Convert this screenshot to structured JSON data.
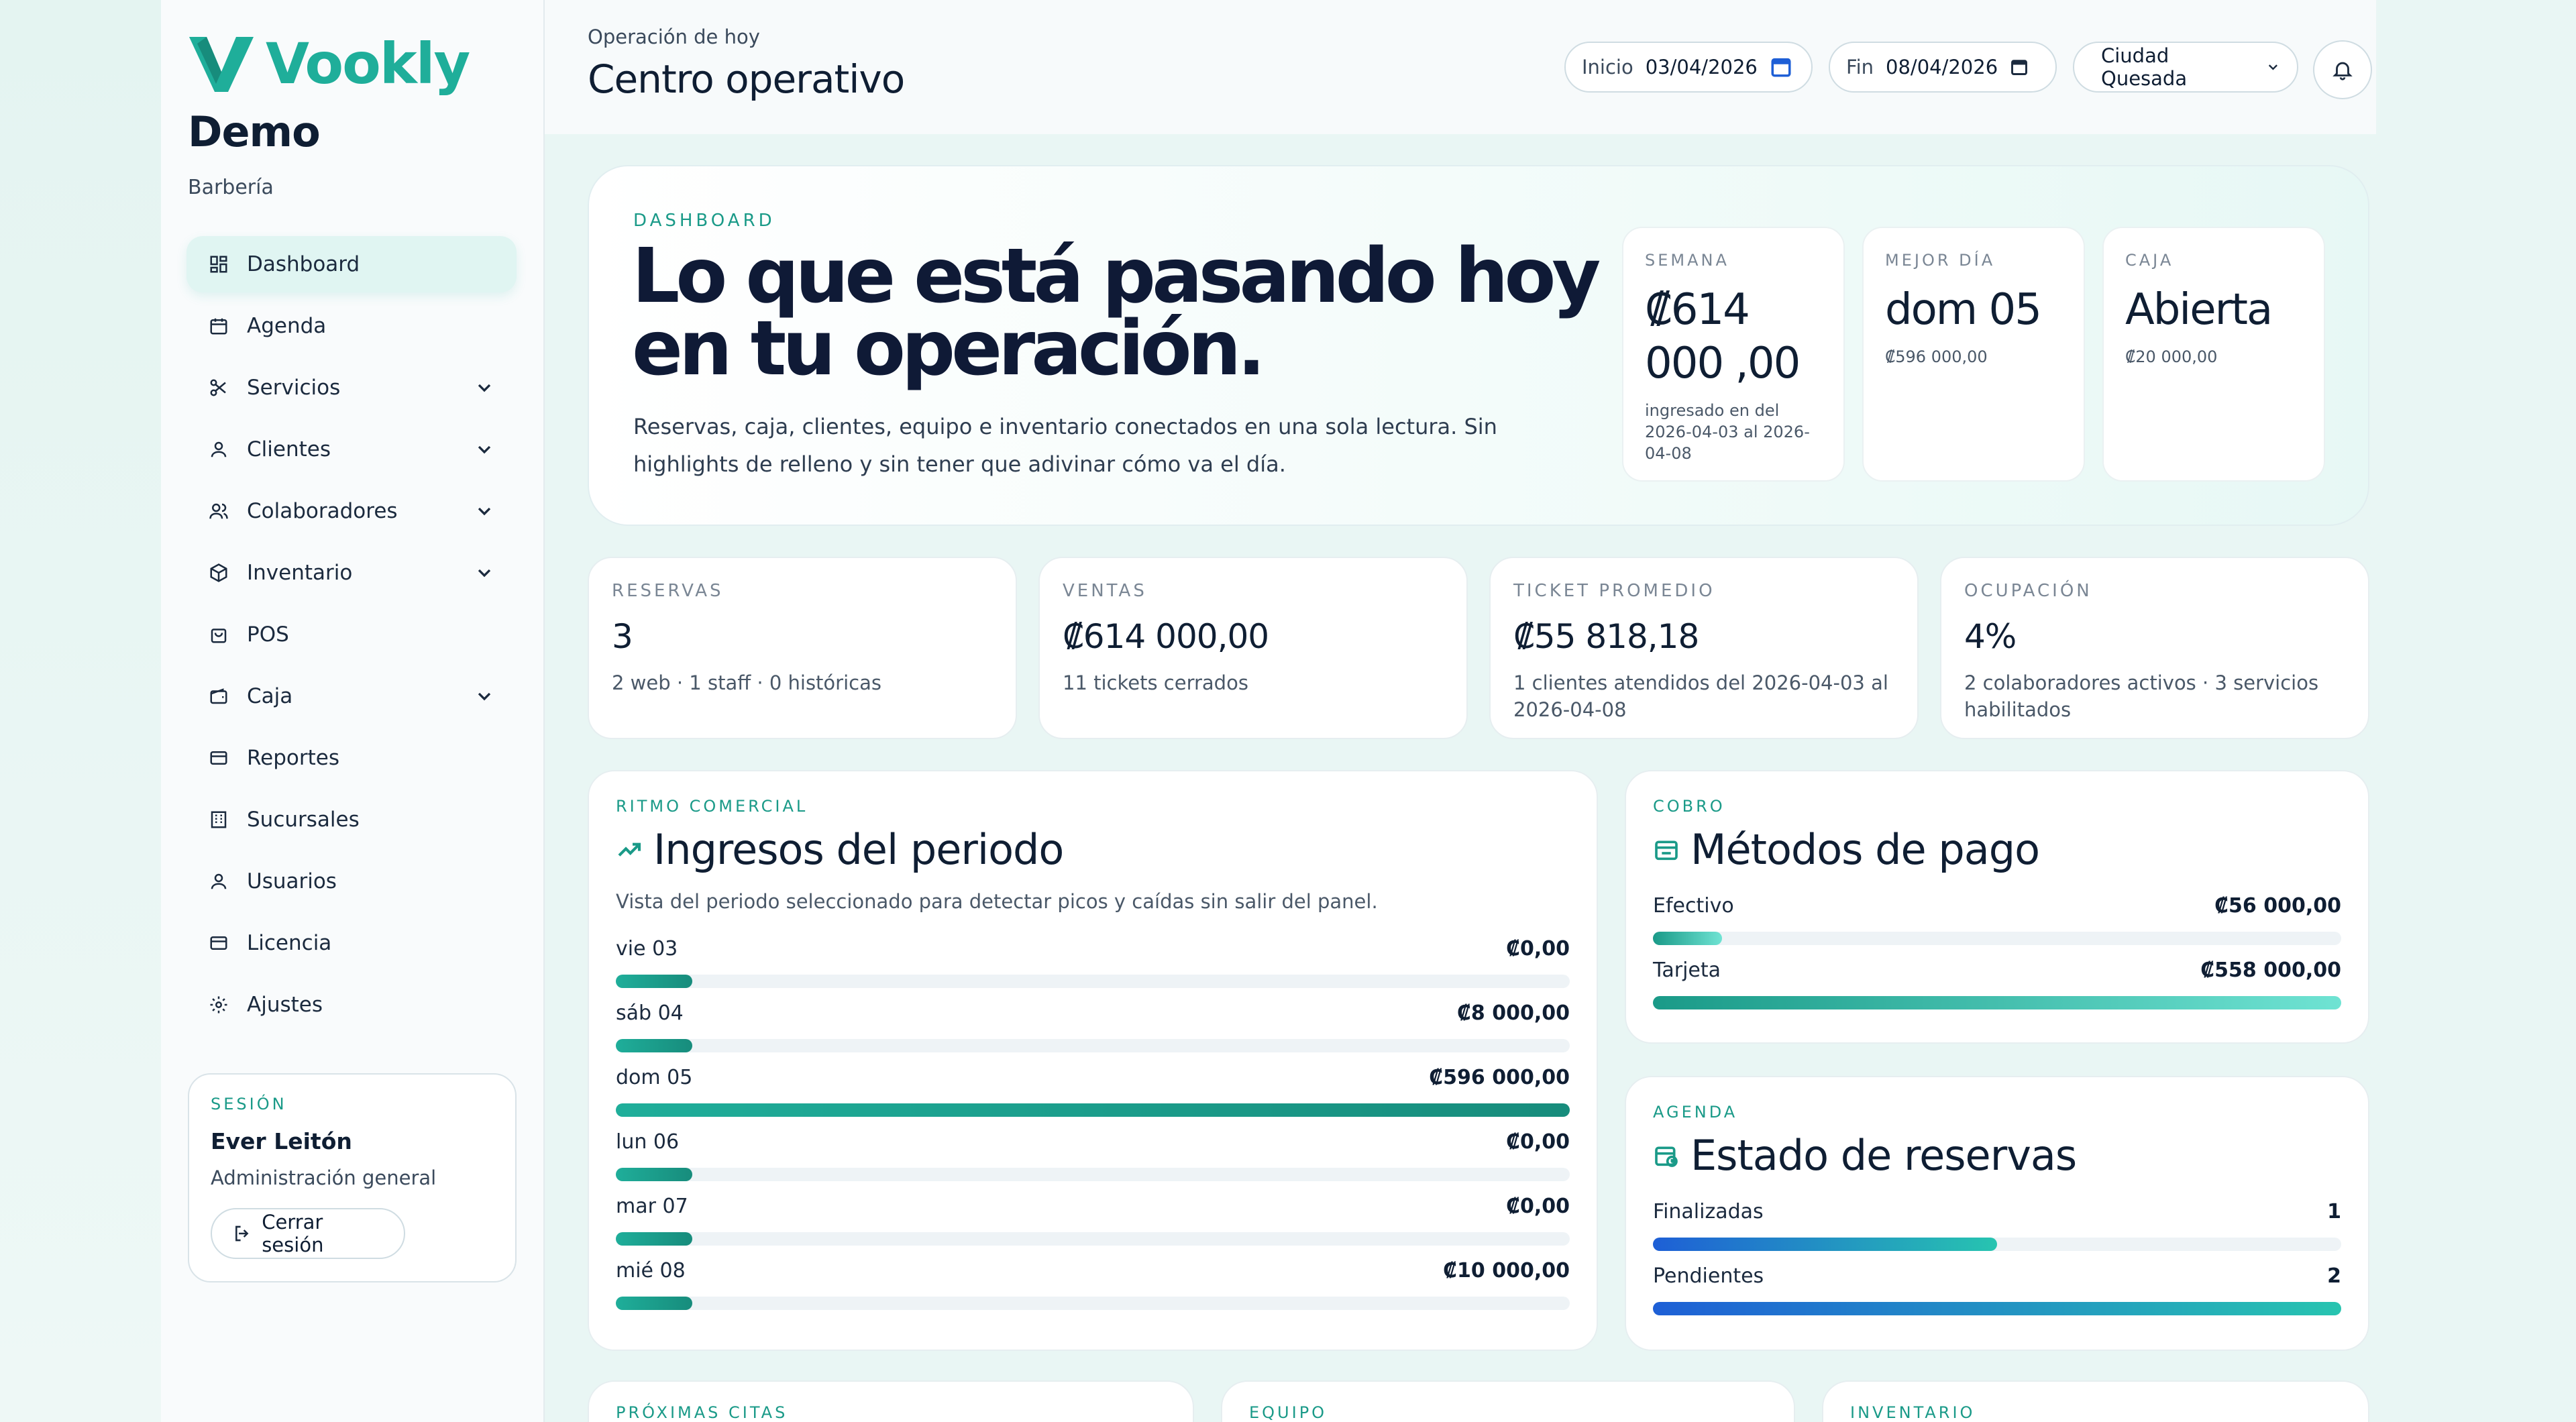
{
  "brand": {
    "name": "Vookly"
  },
  "business": {
    "name": "Demo",
    "type": "Barbería"
  },
  "nav": [
    {
      "label": "Dashboard",
      "icon": "dashboard-icon",
      "expandable": false,
      "active": true
    },
    {
      "label": "Agenda",
      "icon": "calendar-icon",
      "expandable": false
    },
    {
      "label": "Servicios",
      "icon": "scissors-icon",
      "expandable": true
    },
    {
      "label": "Clientes",
      "icon": "user-icon",
      "expandable": true
    },
    {
      "label": "Colaboradores",
      "icon": "users-icon",
      "expandable": true
    },
    {
      "label": "Inventario",
      "icon": "box-icon",
      "expandable": true
    },
    {
      "label": "POS",
      "icon": "bag-icon",
      "expandable": false
    },
    {
      "label": "Caja",
      "icon": "wallet-icon",
      "expandable": true
    },
    {
      "label": "Reportes",
      "icon": "card-icon",
      "expandable": false
    },
    {
      "label": "Sucursales",
      "icon": "building-icon",
      "expandable": false
    },
    {
      "label": "Usuarios",
      "icon": "user-icon",
      "expandable": false
    },
    {
      "label": "Licencia",
      "icon": "card-icon",
      "expandable": false
    },
    {
      "label": "Ajustes",
      "icon": "gear-icon",
      "expandable": false
    }
  ],
  "session": {
    "label": "SESIÓN",
    "name": "Ever Leitón",
    "role": "Administración general",
    "logout": "Cerrar sesión"
  },
  "header": {
    "crumb": "Operación de hoy",
    "title": "Centro operativo",
    "start_label": "Inicio",
    "start_value": "03/04/2026",
    "end_label": "Fin",
    "end_value": "08/04/2026",
    "branch": "Ciudad Quesada"
  },
  "hero": {
    "tag": "DASHBOARD",
    "title": "Lo que está pasando hoy en tu operación.",
    "desc": "Reservas, caja, clientes, equipo e inventario conectados en una sola lectura. Sin highlights de relleno y sin tener que adivinar cómo va el día.",
    "cards": [
      {
        "label": "SEMANA",
        "value": "₡614 000 ,00",
        "sub": "ingresado en del 2026-04-03 al 2026-04-08"
      },
      {
        "label": "MEJOR DÍA",
        "value": "dom 05",
        "sub": "₡596 000,00"
      },
      {
        "label": "CAJA",
        "value": "Abierta",
        "sub": "₡20 000,00"
      }
    ]
  },
  "kpis": [
    {
      "label": "RESERVAS",
      "value": "3",
      "sub": "2 web · 1 staff · 0 históricas"
    },
    {
      "label": "VENTAS",
      "value": "₡614 000,00",
      "sub": "11 tickets cerrados"
    },
    {
      "label": "TICKET PROMEDIO",
      "value": "₡55 818,18",
      "sub": "1 clientes atendidos del 2026-04-03 al 2026-04-08"
    },
    {
      "label": "OCUPACIÓN",
      "value": "4%",
      "sub": "2 colaboradores activos · 3 servicios habilitados"
    }
  ],
  "income": {
    "tag": "RITMO COMERCIAL",
    "title": "Ingresos del periodo",
    "desc": "Vista del periodo seleccionado para detectar picos y caídas sin salir del panel.",
    "rows": [
      {
        "day": "vie 03",
        "value": "₡0,00",
        "fraction": 0.08
      },
      {
        "day": "sáb 04",
        "value": "₡8 000,00",
        "fraction": 0.08
      },
      {
        "day": "dom 05",
        "value": "₡596 000,00",
        "fraction": 1.0
      },
      {
        "day": "lun 06",
        "value": "₡0,00",
        "fraction": 0.08
      },
      {
        "day": "mar 07",
        "value": "₡0,00",
        "fraction": 0.08
      },
      {
        "day": "mié 08",
        "value": "₡10 000,00",
        "fraction": 0.08
      }
    ]
  },
  "payments": {
    "tag": "COBRO",
    "title": "Métodos de pago",
    "rows": [
      {
        "label": "Efectivo",
        "value": "₡56 000,00",
        "fraction": 0.1
      },
      {
        "label": "Tarjeta",
        "value": "₡558 000,00",
        "fraction": 1.0
      }
    ]
  },
  "bookings": {
    "tag": "AGENDA",
    "title": "Estado de reservas",
    "rows": [
      {
        "label": "Finalizadas",
        "value": "1",
        "fraction": 0.5
      },
      {
        "label": "Pendientes",
        "value": "2",
        "fraction": 1.0
      }
    ]
  },
  "bottom_tags": [
    "PRÓXIMAS CITAS",
    "EQUIPO",
    "INVENTARIO"
  ],
  "colors": {
    "accent": "#1fae9a",
    "navy": "#0f1a36",
    "blue": "#1e5fd6"
  }
}
